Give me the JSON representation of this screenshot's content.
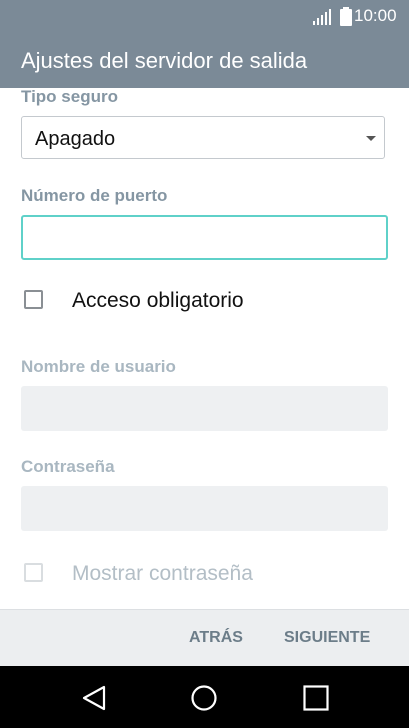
{
  "status_bar": {
    "time": "10:00",
    "signal_icon": "signal-icon",
    "battery_icon": "battery-icon"
  },
  "header": {
    "title": "Ajustes del servidor de salida"
  },
  "form": {
    "security_type": {
      "label": "Tipo seguro",
      "value": "Apagado"
    },
    "port": {
      "label": "Número de puerto",
      "value": ""
    },
    "required_access": {
      "label": "Acceso obligatorio",
      "checked": false
    },
    "username": {
      "label": "Nombre de usuario",
      "value": "",
      "enabled": false
    },
    "password": {
      "label": "Contraseña",
      "value": "",
      "enabled": false
    },
    "show_password": {
      "label": "Mostrar contraseña",
      "checked": false,
      "enabled": false
    }
  },
  "actions": {
    "back_label": "ATRÁS",
    "next_label": "SIGUIENTE"
  },
  "navigation": {
    "back_icon": "triangle-back-icon",
    "home_icon": "circle-home-icon",
    "recents_icon": "square-recents-icon"
  },
  "colors": {
    "header_bg": "#7b8a97",
    "focus_border": "#5fd1c9",
    "label_active": "#8596a3",
    "label_disabled": "#a9b7c1",
    "button_text": "#6c7d89"
  }
}
